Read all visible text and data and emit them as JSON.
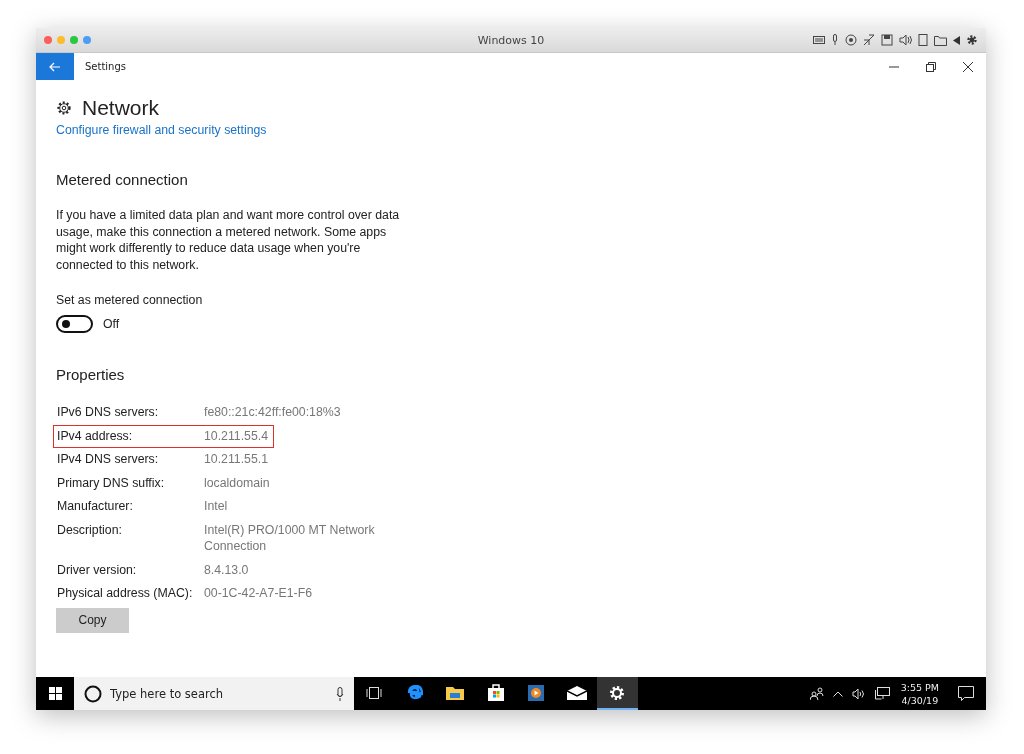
{
  "host_window": {
    "title": "Windows 10"
  },
  "settings_window": {
    "title": "Settings"
  },
  "page": {
    "title": "Network",
    "link": "Configure firewall and security settings"
  },
  "metered": {
    "heading": "Metered connection",
    "description": "If you have a limited data plan and want more control over data usage, make this connection a metered network. Some apps might work differently to reduce data usage when you're connected to this network.",
    "toggle_label": "Set as metered connection",
    "on": false,
    "state_text": "Off"
  },
  "properties": {
    "heading": "Properties",
    "rows": [
      {
        "label": "IPv6 DNS servers:",
        "value": "fe80::21c:42ff:fe00:18%3",
        "highlighted": false
      },
      {
        "label": "IPv4 address:",
        "value": "10.211.55.4",
        "highlighted": true
      },
      {
        "label": "IPv4 DNS servers:",
        "value": "10.211.55.1",
        "highlighted": false
      },
      {
        "label": "Primary DNS suffix:",
        "value": "localdomain",
        "highlighted": false
      },
      {
        "label": "Manufacturer:",
        "value": "Intel",
        "highlighted": false
      },
      {
        "label": "Description:",
        "value": "Intel(R) PRO/1000 MT Network Connection",
        "highlighted": false
      },
      {
        "label": "Driver version:",
        "value": "8.4.13.0",
        "highlighted": false
      },
      {
        "label": "Physical address (MAC):",
        "value": "00-1C-42-A7-E1-F6",
        "highlighted": false
      }
    ],
    "button": "Copy"
  },
  "taskbar": {
    "search_placeholder": "Type here to search",
    "apps": [
      {
        "kind": "taskview",
        "selected": false
      },
      {
        "kind": "edge",
        "selected": false
      },
      {
        "kind": "explorer",
        "selected": false
      },
      {
        "kind": "store",
        "selected": false
      },
      {
        "kind": "media",
        "selected": false
      },
      {
        "kind": "mail",
        "selected": false
      },
      {
        "kind": "settings",
        "selected": true
      }
    ],
    "time": "3:55 PM",
    "date": "4/30/19"
  }
}
